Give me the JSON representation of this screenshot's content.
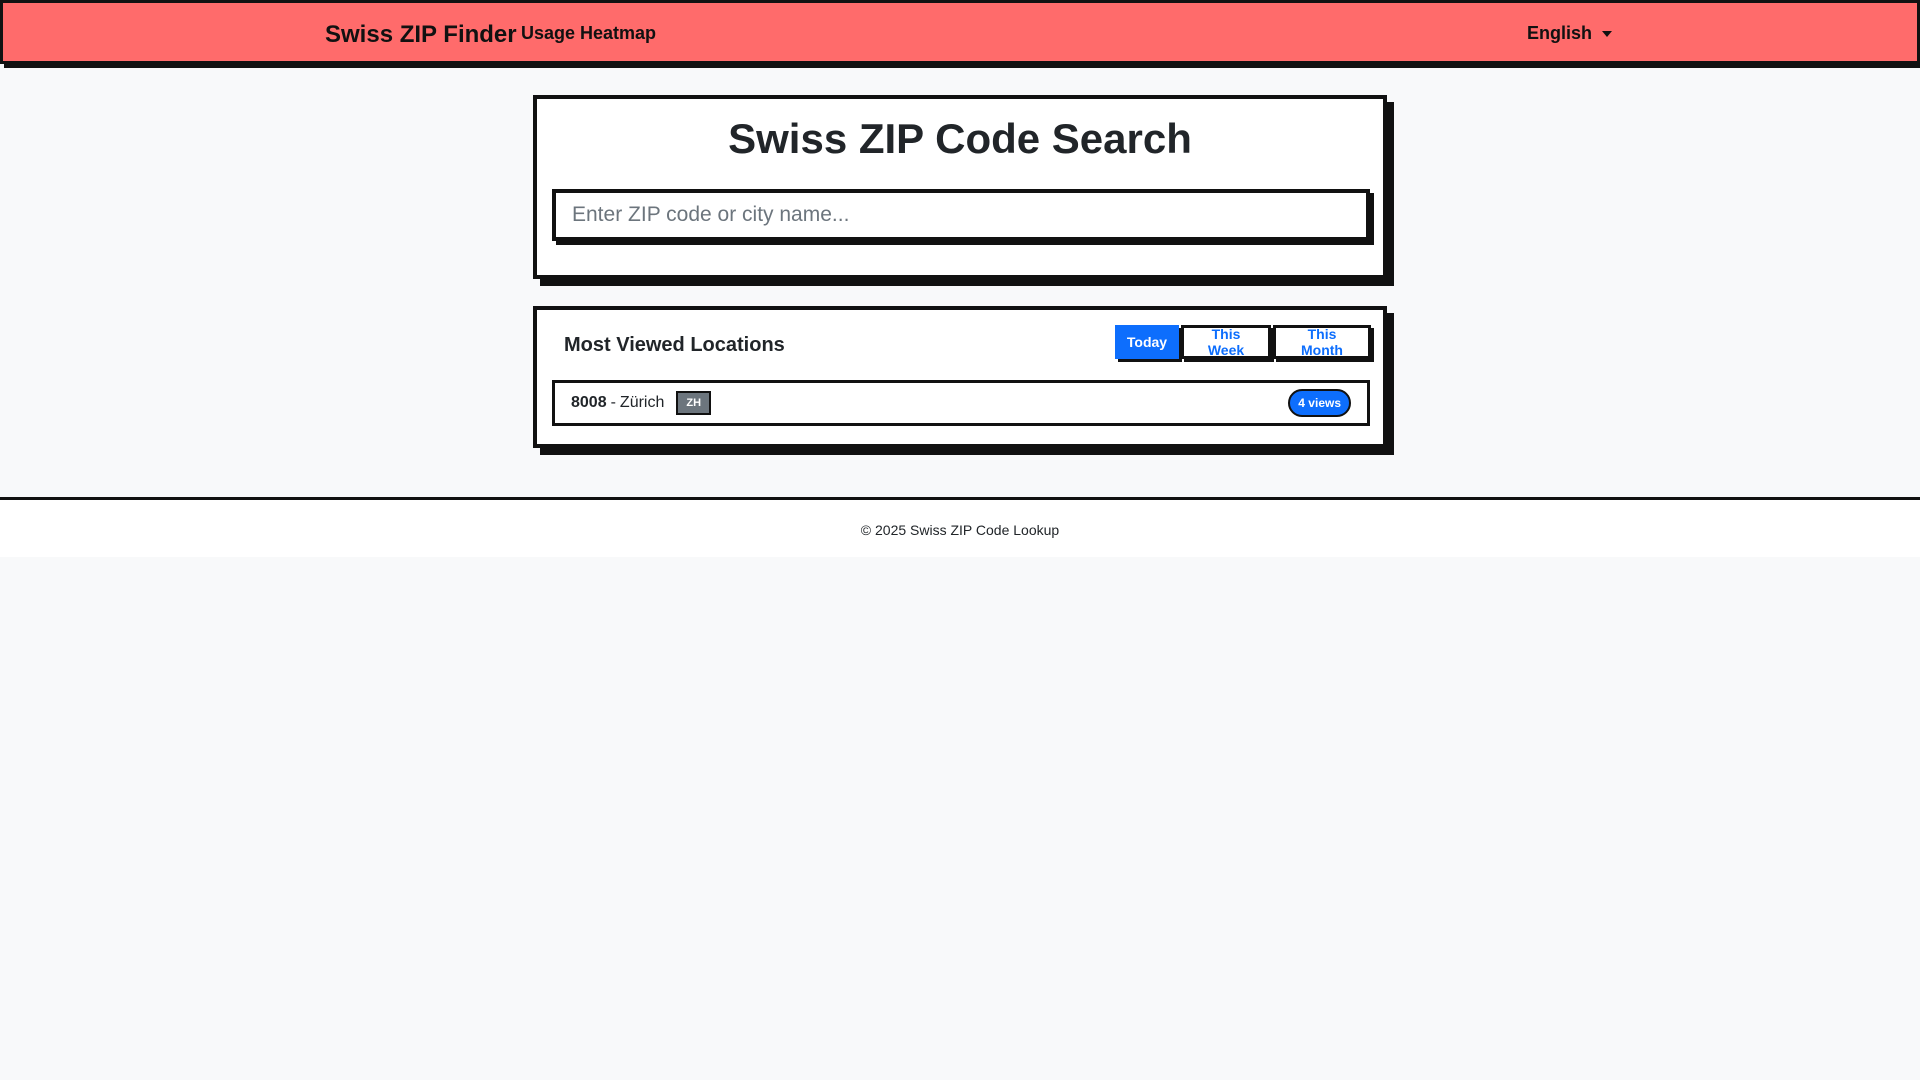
{
  "navbar": {
    "brand": "Swiss ZIP Finder",
    "link": "Usage Heatmap",
    "language": "English"
  },
  "search": {
    "title": "Swiss ZIP Code Search",
    "placeholder": "Enter ZIP code or city name...",
    "value": ""
  },
  "most_viewed": {
    "title": "Most Viewed Locations",
    "tabs": [
      {
        "label": "Today",
        "active": true
      },
      {
        "label": "This Week",
        "active": false
      },
      {
        "label": "This Month",
        "active": false
      }
    ],
    "items": [
      {
        "zip": "8008",
        "separator": "-",
        "city": "Zürich",
        "canton": "ZH",
        "views": "4 views"
      }
    ]
  },
  "footer": {
    "text": "© 2025 Swiss ZIP Code Lookup"
  },
  "colors": {
    "navbar_bg": "#ff6b6b",
    "accent": "#0d6efd",
    "badge_gray": "#6c757d",
    "border": "#111111"
  }
}
